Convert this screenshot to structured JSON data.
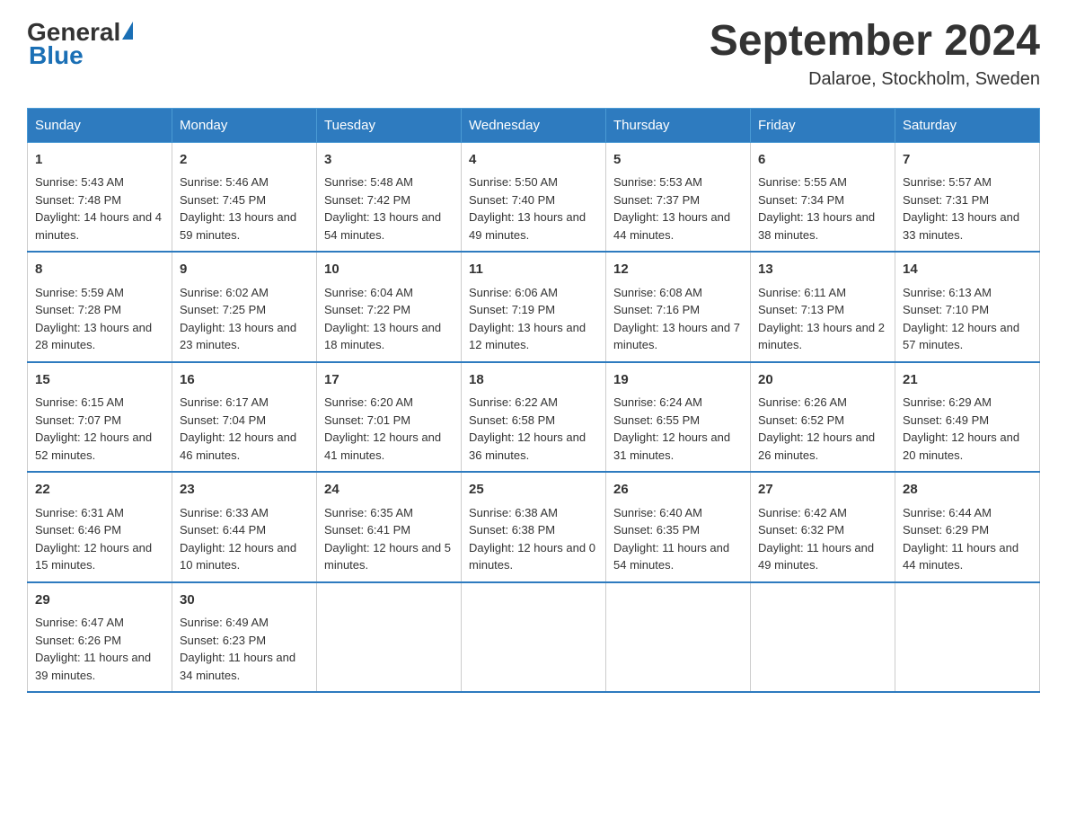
{
  "header": {
    "logo_general": "General",
    "logo_blue": "Blue",
    "month_title": "September 2024",
    "location": "Dalaroe, Stockholm, Sweden"
  },
  "columns": [
    "Sunday",
    "Monday",
    "Tuesday",
    "Wednesday",
    "Thursday",
    "Friday",
    "Saturday"
  ],
  "weeks": [
    [
      {
        "day": "1",
        "sunrise": "Sunrise: 5:43 AM",
        "sunset": "Sunset: 7:48 PM",
        "daylight": "Daylight: 14 hours and 4 minutes."
      },
      {
        "day": "2",
        "sunrise": "Sunrise: 5:46 AM",
        "sunset": "Sunset: 7:45 PM",
        "daylight": "Daylight: 13 hours and 59 minutes."
      },
      {
        "day": "3",
        "sunrise": "Sunrise: 5:48 AM",
        "sunset": "Sunset: 7:42 PM",
        "daylight": "Daylight: 13 hours and 54 minutes."
      },
      {
        "day": "4",
        "sunrise": "Sunrise: 5:50 AM",
        "sunset": "Sunset: 7:40 PM",
        "daylight": "Daylight: 13 hours and 49 minutes."
      },
      {
        "day": "5",
        "sunrise": "Sunrise: 5:53 AM",
        "sunset": "Sunset: 7:37 PM",
        "daylight": "Daylight: 13 hours and 44 minutes."
      },
      {
        "day": "6",
        "sunrise": "Sunrise: 5:55 AM",
        "sunset": "Sunset: 7:34 PM",
        "daylight": "Daylight: 13 hours and 38 minutes."
      },
      {
        "day": "7",
        "sunrise": "Sunrise: 5:57 AM",
        "sunset": "Sunset: 7:31 PM",
        "daylight": "Daylight: 13 hours and 33 minutes."
      }
    ],
    [
      {
        "day": "8",
        "sunrise": "Sunrise: 5:59 AM",
        "sunset": "Sunset: 7:28 PM",
        "daylight": "Daylight: 13 hours and 28 minutes."
      },
      {
        "day": "9",
        "sunrise": "Sunrise: 6:02 AM",
        "sunset": "Sunset: 7:25 PM",
        "daylight": "Daylight: 13 hours and 23 minutes."
      },
      {
        "day": "10",
        "sunrise": "Sunrise: 6:04 AM",
        "sunset": "Sunset: 7:22 PM",
        "daylight": "Daylight: 13 hours and 18 minutes."
      },
      {
        "day": "11",
        "sunrise": "Sunrise: 6:06 AM",
        "sunset": "Sunset: 7:19 PM",
        "daylight": "Daylight: 13 hours and 12 minutes."
      },
      {
        "day": "12",
        "sunrise": "Sunrise: 6:08 AM",
        "sunset": "Sunset: 7:16 PM",
        "daylight": "Daylight: 13 hours and 7 minutes."
      },
      {
        "day": "13",
        "sunrise": "Sunrise: 6:11 AM",
        "sunset": "Sunset: 7:13 PM",
        "daylight": "Daylight: 13 hours and 2 minutes."
      },
      {
        "day": "14",
        "sunrise": "Sunrise: 6:13 AM",
        "sunset": "Sunset: 7:10 PM",
        "daylight": "Daylight: 12 hours and 57 minutes."
      }
    ],
    [
      {
        "day": "15",
        "sunrise": "Sunrise: 6:15 AM",
        "sunset": "Sunset: 7:07 PM",
        "daylight": "Daylight: 12 hours and 52 minutes."
      },
      {
        "day": "16",
        "sunrise": "Sunrise: 6:17 AM",
        "sunset": "Sunset: 7:04 PM",
        "daylight": "Daylight: 12 hours and 46 minutes."
      },
      {
        "day": "17",
        "sunrise": "Sunrise: 6:20 AM",
        "sunset": "Sunset: 7:01 PM",
        "daylight": "Daylight: 12 hours and 41 minutes."
      },
      {
        "day": "18",
        "sunrise": "Sunrise: 6:22 AM",
        "sunset": "Sunset: 6:58 PM",
        "daylight": "Daylight: 12 hours and 36 minutes."
      },
      {
        "day": "19",
        "sunrise": "Sunrise: 6:24 AM",
        "sunset": "Sunset: 6:55 PM",
        "daylight": "Daylight: 12 hours and 31 minutes."
      },
      {
        "day": "20",
        "sunrise": "Sunrise: 6:26 AM",
        "sunset": "Sunset: 6:52 PM",
        "daylight": "Daylight: 12 hours and 26 minutes."
      },
      {
        "day": "21",
        "sunrise": "Sunrise: 6:29 AM",
        "sunset": "Sunset: 6:49 PM",
        "daylight": "Daylight: 12 hours and 20 minutes."
      }
    ],
    [
      {
        "day": "22",
        "sunrise": "Sunrise: 6:31 AM",
        "sunset": "Sunset: 6:46 PM",
        "daylight": "Daylight: 12 hours and 15 minutes."
      },
      {
        "day": "23",
        "sunrise": "Sunrise: 6:33 AM",
        "sunset": "Sunset: 6:44 PM",
        "daylight": "Daylight: 12 hours and 10 minutes."
      },
      {
        "day": "24",
        "sunrise": "Sunrise: 6:35 AM",
        "sunset": "Sunset: 6:41 PM",
        "daylight": "Daylight: 12 hours and 5 minutes."
      },
      {
        "day": "25",
        "sunrise": "Sunrise: 6:38 AM",
        "sunset": "Sunset: 6:38 PM",
        "daylight": "Daylight: 12 hours and 0 minutes."
      },
      {
        "day": "26",
        "sunrise": "Sunrise: 6:40 AM",
        "sunset": "Sunset: 6:35 PM",
        "daylight": "Daylight: 11 hours and 54 minutes."
      },
      {
        "day": "27",
        "sunrise": "Sunrise: 6:42 AM",
        "sunset": "Sunset: 6:32 PM",
        "daylight": "Daylight: 11 hours and 49 minutes."
      },
      {
        "day": "28",
        "sunrise": "Sunrise: 6:44 AM",
        "sunset": "Sunset: 6:29 PM",
        "daylight": "Daylight: 11 hours and 44 minutes."
      }
    ],
    [
      {
        "day": "29",
        "sunrise": "Sunrise: 6:47 AM",
        "sunset": "Sunset: 6:26 PM",
        "daylight": "Daylight: 11 hours and 39 minutes."
      },
      {
        "day": "30",
        "sunrise": "Sunrise: 6:49 AM",
        "sunset": "Sunset: 6:23 PM",
        "daylight": "Daylight: 11 hours and 34 minutes."
      },
      null,
      null,
      null,
      null,
      null
    ]
  ]
}
